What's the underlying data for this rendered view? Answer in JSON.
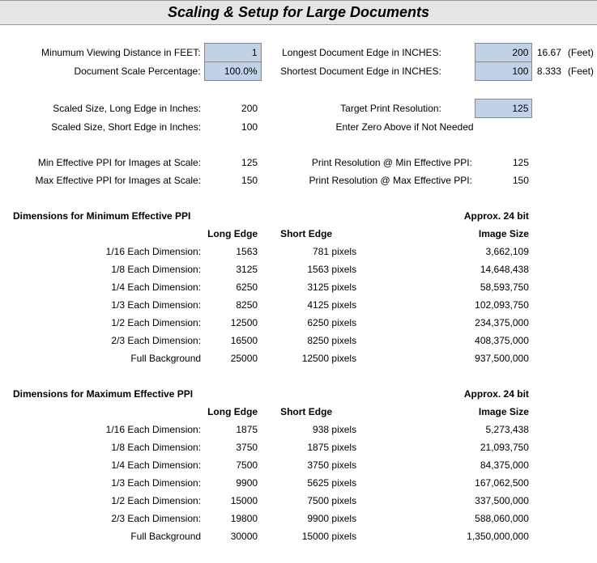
{
  "title": "Scaling & Setup for Large Documents",
  "inputs": {
    "min_view_dist_label": "Minumum Viewing Distance in FEET:",
    "min_view_dist_value": "1",
    "doc_scale_label": "Document Scale Percentage:",
    "doc_scale_value": "100.0%",
    "longest_edge_label": "Longest Document Edge in INCHES:",
    "longest_edge_value": "200",
    "longest_edge_feet": "16.67",
    "shortest_edge_label": "Shortest Document Edge in INCHES:",
    "shortest_edge_value": "100",
    "shortest_edge_feet": "8.333",
    "feet_unit": "(Feet)"
  },
  "scaled": {
    "long_label": "Scaled Size, Long Edge in Inches:",
    "long_value": "200",
    "short_label": "Scaled Size, Short Edge in Inches:",
    "short_value": "100",
    "target_res_label": "Target Print Resolution:",
    "target_res_value": "125",
    "zero_note": "Enter Zero Above if Not Needed"
  },
  "ppi": {
    "min_label": "Min Effective PPI for Images at Scale:",
    "min_value": "125",
    "max_label": "Max Effective PPI for Images at Scale:",
    "max_value": "150",
    "print_min_label": "Print Resolution @ Min Effective PPI:",
    "print_min_value": "125",
    "print_max_label": "Print Resolution @ Max Effective PPI:",
    "print_max_value": "150"
  },
  "headers": {
    "long_edge": "Long Edge",
    "short_edge": "Short Edge",
    "approx": "Approx. 24 bit",
    "image_size": "Image Size",
    "pixels": "pixels"
  },
  "min_section": {
    "title": "Dimensions for Minimum Effective PPI",
    "rows": [
      {
        "label": "1/16 Each Dimension:",
        "long": "1563",
        "short": "781",
        "size": "3,662,109"
      },
      {
        "label": "1/8 Each Dimension:",
        "long": "3125",
        "short": "1563",
        "size": "14,648,438"
      },
      {
        "label": "1/4 Each Dimension:",
        "long": "6250",
        "short": "3125",
        "size": "58,593,750"
      },
      {
        "label": "1/3 Each Dimension:",
        "long": "8250",
        "short": "4125",
        "size": "102,093,750"
      },
      {
        "label": "1/2 Each Dimension:",
        "long": "12500",
        "short": "6250",
        "size": "234,375,000"
      },
      {
        "label": "2/3 Each Dimension:",
        "long": "16500",
        "short": "8250",
        "size": "408,375,000"
      },
      {
        "label": "Full Background",
        "long": "25000",
        "short": "12500",
        "size": "937,500,000"
      }
    ]
  },
  "max_section": {
    "title": "Dimensions for Maximum Effective PPI",
    "rows": [
      {
        "label": "1/16 Each Dimension:",
        "long": "1875",
        "short": "938",
        "size": "5,273,438"
      },
      {
        "label": "1/8 Each Dimension:",
        "long": "3750",
        "short": "1875",
        "size": "21,093,750"
      },
      {
        "label": "1/4 Each Dimension:",
        "long": "7500",
        "short": "3750",
        "size": "84,375,000"
      },
      {
        "label": "1/3 Each Dimension:",
        "long": "9900",
        "short": "5625",
        "size": "167,062,500"
      },
      {
        "label": "1/2 Each Dimension:",
        "long": "15000",
        "short": "7500",
        "size": "337,500,000"
      },
      {
        "label": "2/3 Each Dimension:",
        "long": "19800",
        "short": "9900",
        "size": "588,060,000"
      },
      {
        "label": "Full Background",
        "long": "30000",
        "short": "15000",
        "size": "1,350,000,000"
      }
    ]
  }
}
